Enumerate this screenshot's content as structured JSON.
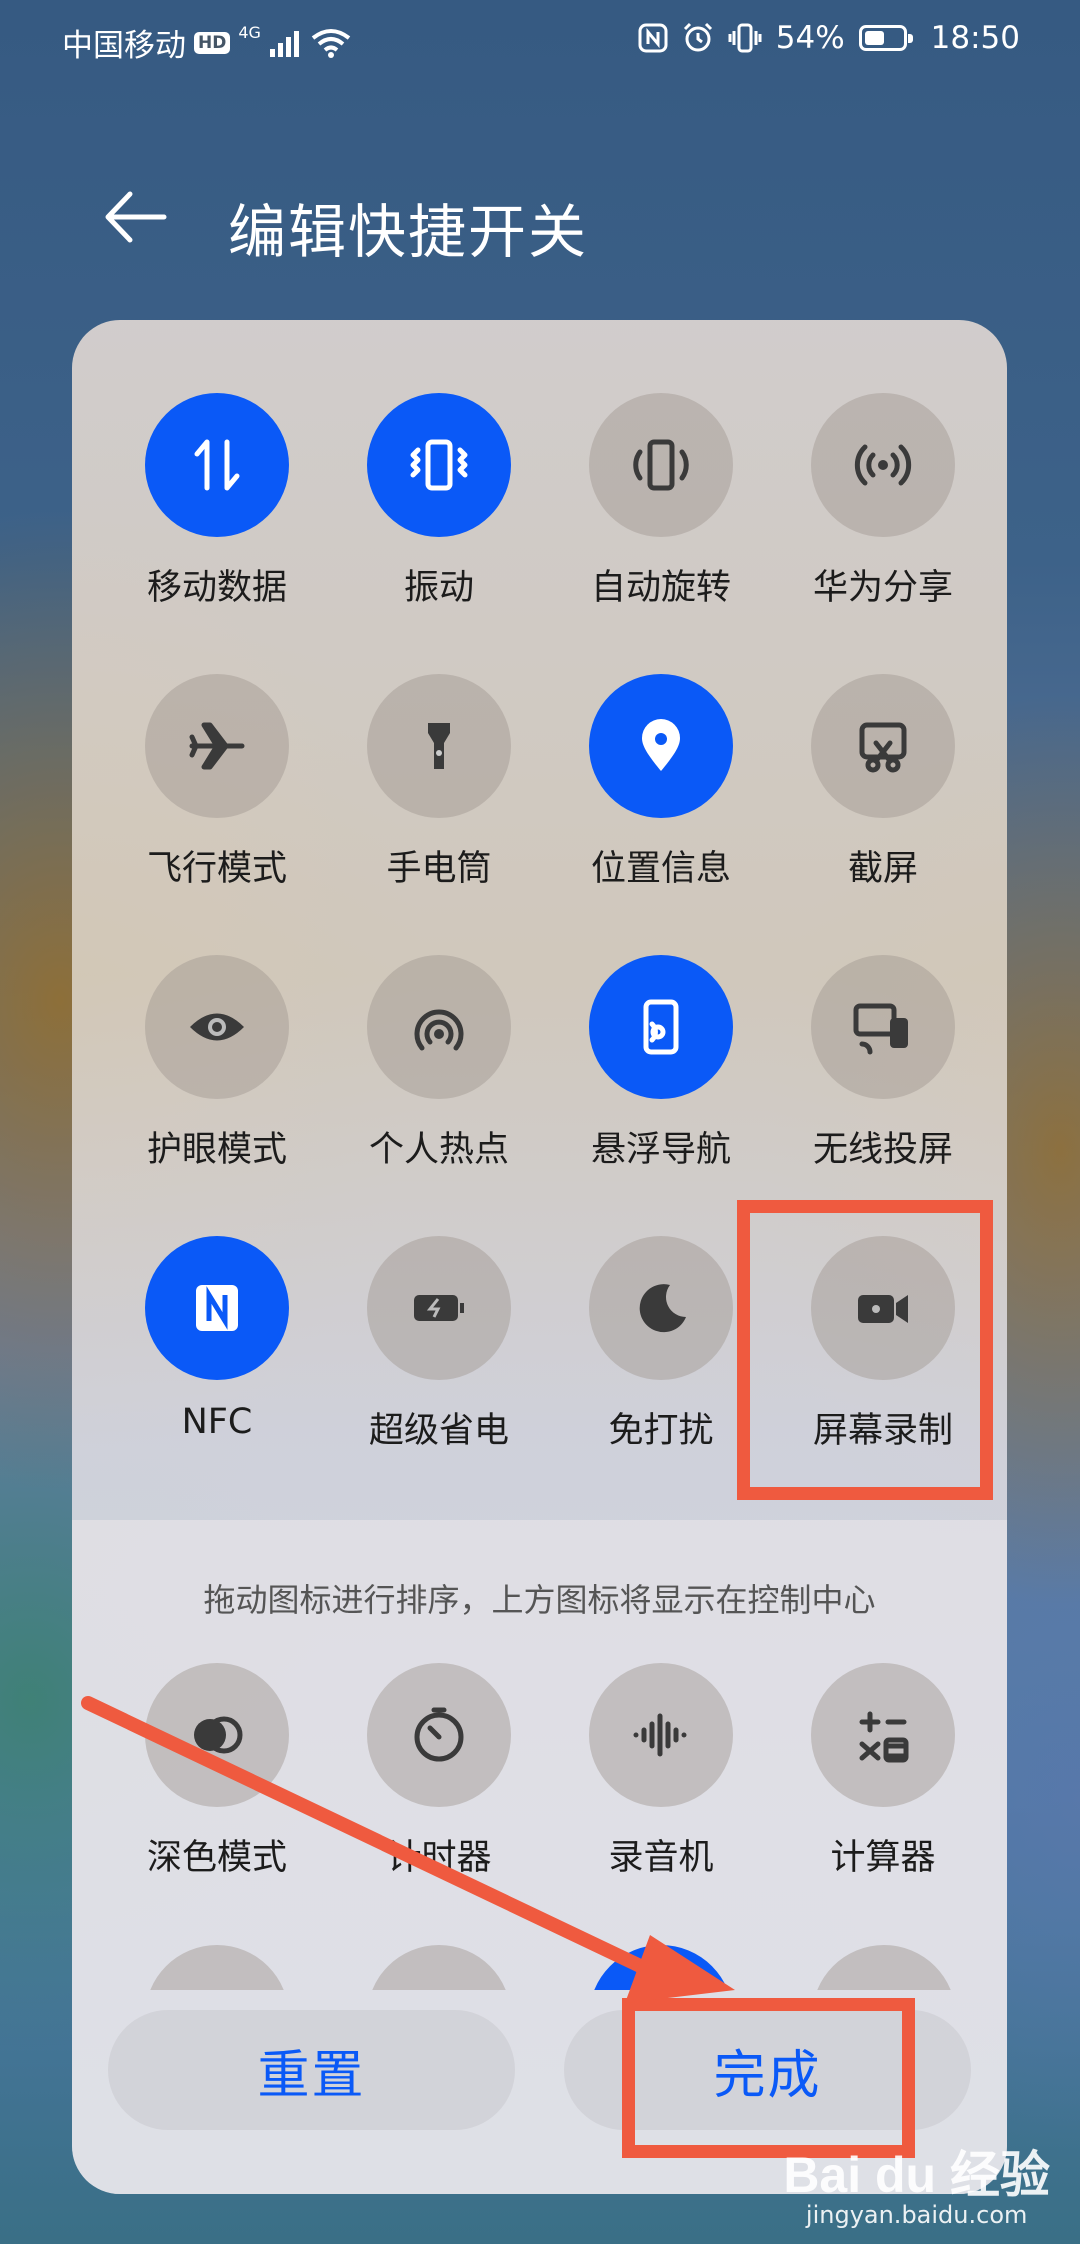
{
  "status_bar": {
    "carrier": "中国移动",
    "hd": "HD",
    "network": "4G",
    "battery_pct": "54%",
    "battery_level": 0.54,
    "time": "18:50"
  },
  "header": {
    "title": "编辑快捷开关"
  },
  "active_tiles": [
    {
      "label": "移动数据",
      "icon": "swap-vertical-icon",
      "on": true
    },
    {
      "label": "振动",
      "icon": "vibrate-icon",
      "on": true
    },
    {
      "label": "自动旋转",
      "icon": "auto-rotate-icon",
      "on": false
    },
    {
      "label": "华为分享",
      "icon": "share-broadcast-icon",
      "on": false
    },
    {
      "label": "飞行模式",
      "icon": "airplane-icon",
      "on": false
    },
    {
      "label": "手电筒",
      "icon": "flashlight-icon",
      "on": false
    },
    {
      "label": "位置信息",
      "icon": "location-pin-icon",
      "on": true
    },
    {
      "label": "截屏",
      "icon": "screenshot-scissors-icon",
      "on": false
    },
    {
      "label": "护眼模式",
      "icon": "eye-icon",
      "on": false
    },
    {
      "label": "个人热点",
      "icon": "hotspot-icon",
      "on": false
    },
    {
      "label": "悬浮导航",
      "icon": "floating-nav-icon",
      "on": true
    },
    {
      "label": "无线投屏",
      "icon": "wireless-projection-icon",
      "on": false
    },
    {
      "label": "NFC",
      "icon": "nfc-icon",
      "on": true
    },
    {
      "label": "超级省电",
      "icon": "battery-saver-icon",
      "on": false
    },
    {
      "label": "免打扰",
      "icon": "moon-icon",
      "on": false
    },
    {
      "label": "屏幕录制",
      "icon": "video-camera-icon",
      "on": false
    }
  ],
  "hint": "拖动图标进行排序，上方图标将显示在控制中心",
  "available_tiles": [
    {
      "label": "深色模式",
      "icon": "dark-mode-icon",
      "on": false
    },
    {
      "label": "计时器",
      "icon": "timer-icon",
      "on": false
    },
    {
      "label": "录音机",
      "icon": "waveform-icon",
      "on": false
    },
    {
      "label": "计算器",
      "icon": "calculator-icon",
      "on": false
    }
  ],
  "buttons": {
    "reset": "重置",
    "done": "完成"
  },
  "colors": {
    "accent": "#0a59f7",
    "annotation": "#ef5a3f"
  },
  "watermark": {
    "logo": "Bai du 经验",
    "url": "jingyan.baidu.com"
  }
}
